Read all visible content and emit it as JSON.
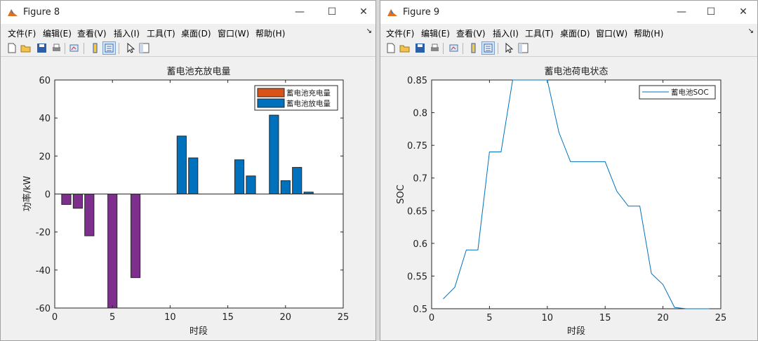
{
  "windows": [
    {
      "title": "Figure 8",
      "menu": [
        "文件(F)",
        "编辑(E)",
        "查看(V)",
        "插入(I)",
        "工具(T)",
        "桌面(D)",
        "窗口(W)",
        "帮助(H)"
      ],
      "toolbar_icons": [
        "new-figure-icon",
        "open-file-icon",
        "save-icon",
        "print-icon",
        "link-plot-icon",
        "insert-colorbar-icon",
        "insert-legend-icon",
        "edit-plot-icon",
        "property-inspector-icon"
      ],
      "controls": {
        "minimize": "—",
        "maximize": "☐",
        "close": "✕"
      }
    },
    {
      "title": "Figure 9",
      "menu": [
        "文件(F)",
        "编辑(E)",
        "查看(V)",
        "插入(I)",
        "工具(T)",
        "桌面(D)",
        "窗口(W)",
        "帮助(H)"
      ],
      "toolbar_icons": [
        "new-figure-icon",
        "open-file-icon",
        "save-icon",
        "print-icon",
        "link-plot-icon",
        "insert-colorbar-icon",
        "insert-legend-icon",
        "edit-plot-icon",
        "property-inspector-icon"
      ],
      "controls": {
        "minimize": "—",
        "maximize": "☐",
        "close": "✕"
      }
    }
  ],
  "chart_data": [
    {
      "type": "bar",
      "title": "蓄电池充放电量",
      "xlabel": "时段",
      "ylabel": "功率/kW",
      "xlim": [
        0,
        25
      ],
      "ylim": [
        -60,
        60
      ],
      "xticks": [
        0,
        5,
        10,
        15,
        20,
        25
      ],
      "yticks": [
        -60,
        -40,
        -20,
        0,
        20,
        40,
        60
      ],
      "legend_position": "top-right",
      "series": [
        {
          "name": "蓄电池充电量",
          "color": "#d95319",
          "x": [
            1,
            2,
            3,
            5,
            7
          ],
          "values": [
            -5.5,
            -7.5,
            -22,
            -60,
            -44
          ],
          "display_color": "#7e2f8e"
        },
        {
          "name": "蓄电池放电量",
          "color": "#0072bd",
          "x": [
            11,
            12,
            16,
            17,
            19,
            20,
            21,
            22
          ],
          "values": [
            30.5,
            19,
            18,
            9.5,
            41.5,
            7,
            14,
            1
          ]
        }
      ]
    },
    {
      "type": "line",
      "title": "蓄电池荷电状态",
      "xlabel": "时段",
      "ylabel": "SOC",
      "xlim": [
        0,
        25
      ],
      "ylim": [
        0.5,
        0.85
      ],
      "xticks": [
        0,
        5,
        10,
        15,
        20,
        25
      ],
      "yticks": [
        0.5,
        0.55,
        0.6,
        0.65,
        0.7,
        0.75,
        0.8,
        0.85
      ],
      "legend_position": "top-right",
      "series": [
        {
          "name": "蓄电池SOC",
          "color": "#0072bd",
          "x": [
            1,
            2,
            3,
            4,
            5,
            6,
            7,
            8,
            9,
            10,
            11,
            12,
            13,
            14,
            15,
            16,
            17,
            18,
            19,
            20,
            21,
            22,
            23,
            24
          ],
          "values": [
            0.515,
            0.533,
            0.59,
            0.59,
            0.74,
            0.74,
            0.85,
            0.85,
            0.85,
            0.85,
            0.77,
            0.725,
            0.725,
            0.725,
            0.725,
            0.68,
            0.657,
            0.657,
            0.554,
            0.537,
            0.502,
            0.5,
            0.5,
            0.5
          ]
        }
      ]
    }
  ]
}
